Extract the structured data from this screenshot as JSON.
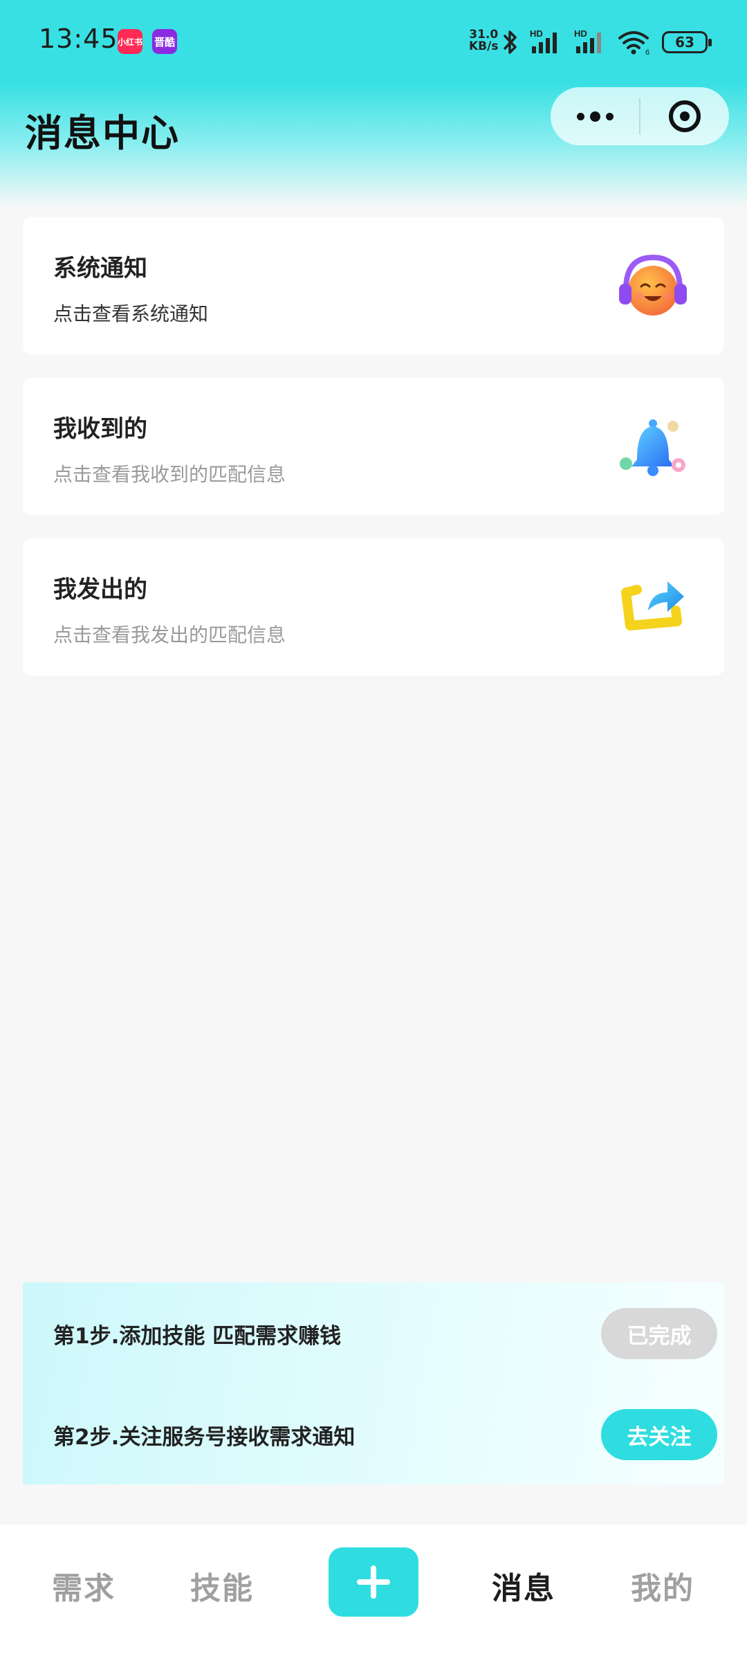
{
  "status_bar": {
    "time": "13:45",
    "app_badges": [
      "小红书",
      "晋酷"
    ],
    "net_speed_value": "31.0",
    "net_speed_unit": "KB/s",
    "signal_label_1": "HD",
    "signal_label_2": "HD",
    "wifi_sub": "6",
    "battery": "63",
    "icons": [
      "bluetooth-icon",
      "signal-icon",
      "signal-icon",
      "wifi-icon",
      "battery-icon"
    ]
  },
  "header": {
    "title": "消息中心",
    "capsule_icons": [
      "more-icon",
      "close-target-icon"
    ]
  },
  "cards": [
    {
      "title": "系统通知",
      "subtitle": "点击查看系统通知",
      "icon": "headphone-emoji-icon"
    },
    {
      "title": "我收到的",
      "subtitle": "点击查看我收到的匹配信息",
      "icon": "bell-icon"
    },
    {
      "title": "我发出的",
      "subtitle": "点击查看我发出的匹配信息",
      "icon": "share-arrow-icon"
    }
  ],
  "steps": [
    {
      "text": "第1步.添加技能 匹配需求赚钱",
      "button": "已完成"
    },
    {
      "text": "第2步.关注服务号接收需求通知",
      "button": "去关注"
    }
  ],
  "tabbar": {
    "items": [
      "需求",
      "技能",
      "消息",
      "我的"
    ],
    "active": "消息",
    "center_icon": "plus-icon"
  },
  "colors": {
    "accent": "#2fdde0",
    "header_top": "#38e0e3",
    "done_button": "#d8d8d8"
  }
}
